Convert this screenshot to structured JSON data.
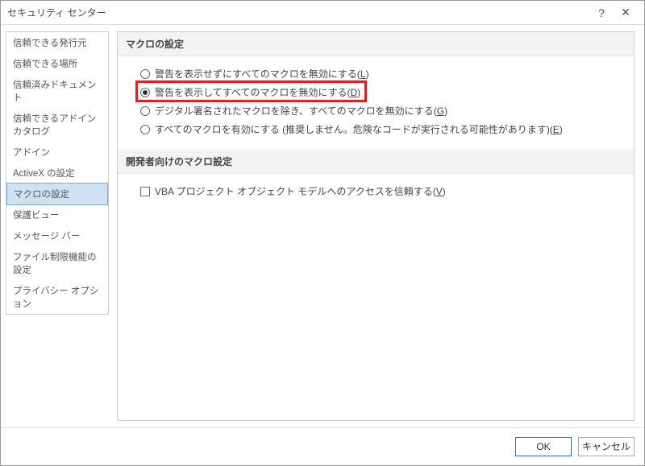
{
  "window": {
    "title": "セキュリティ センター",
    "help": "?",
    "close": "✕"
  },
  "sidebar": {
    "items": [
      {
        "label": "信頼できる発行元"
      },
      {
        "label": "信頼できる場所"
      },
      {
        "label": "信頼済みドキュメント"
      },
      {
        "label": "信頼できるアドイン カタログ"
      },
      {
        "label": "アドイン"
      },
      {
        "label": "ActiveX の設定"
      },
      {
        "label": "マクロの設定"
      },
      {
        "label": "保護ビュー"
      },
      {
        "label": "メッセージ バー"
      },
      {
        "label": "ファイル制限機能の設定"
      },
      {
        "label": "プライバシー オプション"
      }
    ],
    "selected_index": 6
  },
  "content": {
    "section1": {
      "title": "マクロの設定",
      "options": [
        {
          "text": "警告を表示せずにすべてのマクロを無効にする",
          "shortcut": "L",
          "checked": false
        },
        {
          "text": "警告を表示してすべてのマクロを無効にする",
          "shortcut": "D",
          "checked": true,
          "highlighted": true
        },
        {
          "text": "デジタル署名されたマクロを除き、すべてのマクロを無効にする",
          "shortcut": "G",
          "checked": false
        },
        {
          "text": "すべてのマクロを有効にする (推奨しません。危険なコードが実行される可能性があります)",
          "shortcut": "E",
          "checked": false
        }
      ]
    },
    "section2": {
      "title": "開発者向けのマクロ設定",
      "checkbox": {
        "text": "VBA プロジェクト オブジェクト モデルへのアクセスを信頼する",
        "shortcut": "V",
        "checked": false
      }
    }
  },
  "footer": {
    "ok": "OK",
    "cancel": "キャンセル"
  }
}
